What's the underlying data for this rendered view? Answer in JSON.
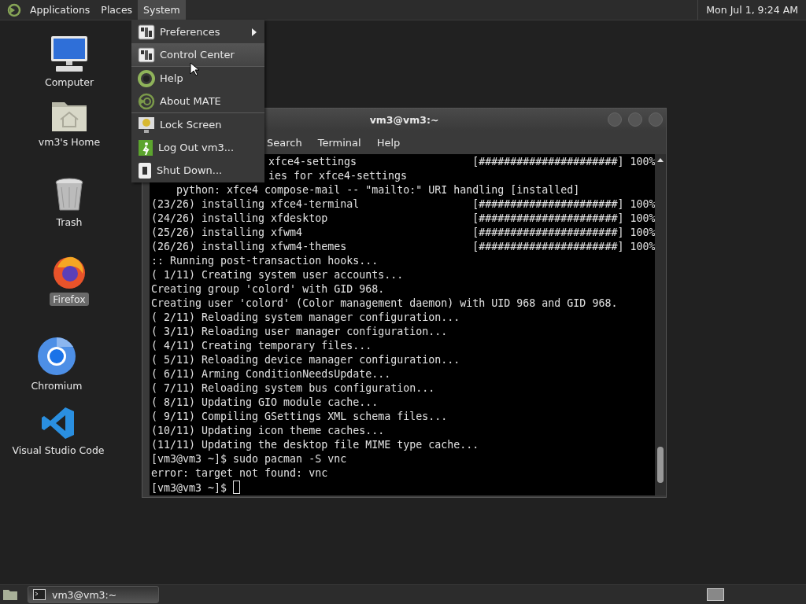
{
  "top_panel": {
    "menus": [
      {
        "label": "Applications",
        "selected": false
      },
      {
        "label": "Places",
        "selected": false
      },
      {
        "label": "System",
        "selected": true
      }
    ],
    "clock": "Mon Jul 1, 9:24 AM"
  },
  "desktop_icons": [
    {
      "label": "Computer",
      "kind": "computer",
      "selected": false
    },
    {
      "label": "vm3's Home",
      "kind": "home",
      "selected": false
    },
    {
      "label": "Trash",
      "kind": "trash",
      "selected": false
    },
    {
      "label": "Firefox",
      "kind": "firefox",
      "selected": true
    },
    {
      "label": "Chromium",
      "kind": "chromium",
      "selected": false
    },
    {
      "label": "Visual Studio Code",
      "kind": "vscode",
      "selected": false
    }
  ],
  "terminal": {
    "title": "vm3@vm3:~",
    "menus": [
      "Search",
      "Terminal",
      "Help"
    ],
    "cursor": true,
    "lines": [
      {
        "kind": "covered",
        "text": "xfce4-settings",
        "progress": "[######################] 100%"
      },
      {
        "kind": "covered",
        "text": "ies for xfce4-settings"
      },
      {
        "kind": "indent",
        "text": "python: xfce4 compose-mail -- \"mailto:\" URI handling [installed]"
      },
      {
        "kind": "plain",
        "text": "(23/26) installing xfce4-terminal",
        "progress": "[######################] 100%"
      },
      {
        "kind": "plain",
        "text": "(24/26) installing xfdesktop",
        "progress": "[######################] 100%"
      },
      {
        "kind": "plain",
        "text": "(25/26) installing xfwm4",
        "progress": "[######################] 100%"
      },
      {
        "kind": "plain",
        "text": "(26/26) installing xfwm4-themes",
        "progress": "[######################] 100%"
      },
      {
        "kind": "plain",
        "text": ":: Running post-transaction hooks..."
      },
      {
        "kind": "plain",
        "text": "( 1/11) Creating system user accounts..."
      },
      {
        "kind": "plain",
        "text": "Creating group 'colord' with GID 968."
      },
      {
        "kind": "plain",
        "text": "Creating user 'colord' (Color management daemon) with UID 968 and GID 968."
      },
      {
        "kind": "plain",
        "text": "( 2/11) Reloading system manager configuration..."
      },
      {
        "kind": "plain",
        "text": "( 3/11) Reloading user manager configuration..."
      },
      {
        "kind": "plain",
        "text": "( 4/11) Creating temporary files..."
      },
      {
        "kind": "plain",
        "text": "( 5/11) Reloading device manager configuration..."
      },
      {
        "kind": "plain",
        "text": "( 6/11) Arming ConditionNeedsUpdate..."
      },
      {
        "kind": "plain",
        "text": "( 7/11) Reloading system bus configuration..."
      },
      {
        "kind": "plain",
        "text": "( 8/11) Updating GIO module cache..."
      },
      {
        "kind": "plain",
        "text": "( 9/11) Compiling GSettings XML schema files..."
      },
      {
        "kind": "plain",
        "text": "(10/11) Updating icon theme caches..."
      },
      {
        "kind": "plain",
        "text": "(11/11) Updating the desktop file MIME type cache..."
      },
      {
        "kind": "plain",
        "text": "[vm3@vm3 ~]$ sudo pacman -S vnc"
      },
      {
        "kind": "plain",
        "text": "error: target not found: vnc"
      },
      {
        "kind": "prompt",
        "text": "[vm3@vm3 ~]$"
      }
    ]
  },
  "system_menu": {
    "items": [
      {
        "label": "Preferences",
        "kind": "prefs",
        "submenu": true,
        "separator_before": false,
        "selected": false
      },
      {
        "label": "Control Center",
        "kind": "control",
        "submenu": false,
        "separator_before": false,
        "selected": true
      },
      {
        "label": "Help",
        "kind": "help",
        "submenu": false,
        "separator_before": true,
        "selected": false
      },
      {
        "label": "About MATE",
        "kind": "about",
        "submenu": false,
        "separator_before": false,
        "selected": false
      },
      {
        "label": "Lock Screen",
        "kind": "lock",
        "submenu": false,
        "separator_before": true,
        "selected": false
      },
      {
        "label": "Log Out vm3...",
        "kind": "logout",
        "submenu": false,
        "separator_before": false,
        "selected": false
      },
      {
        "label": "Shut Down...",
        "kind": "shutdown",
        "submenu": false,
        "separator_before": false,
        "selected": false
      }
    ]
  },
  "bottom_panel": {
    "tasks": [
      {
        "label": "vm3@vm3:~"
      }
    ]
  }
}
